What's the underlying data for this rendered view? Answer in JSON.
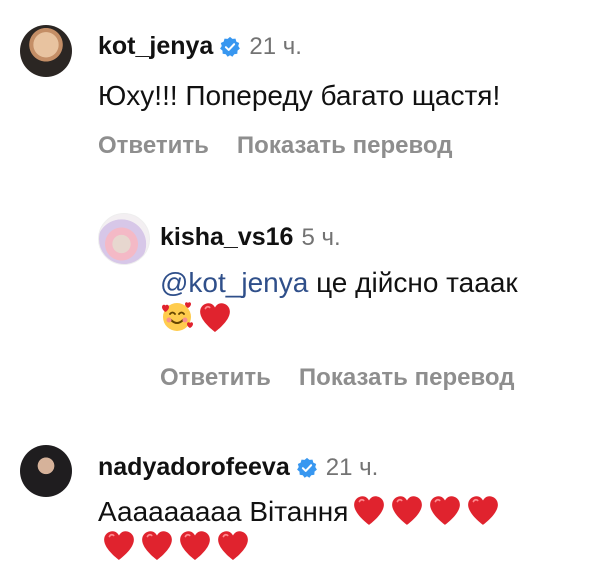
{
  "comments": [
    {
      "username": "kot_jenya",
      "verified": true,
      "time": "21 ч.",
      "text": "Юху!!! Попереду багато щастя!",
      "actions": [
        "Ответить",
        "Показать перевод"
      ]
    },
    {
      "username": "kisha_vs16",
      "verified": false,
      "time": "5 ч.",
      "mention": "@kot_jenya",
      "text": " це дійсно тааак",
      "emojis": [
        "smiling-face-with-hearts",
        "red-heart"
      ],
      "actions": [
        "Ответить",
        "Показать перевод"
      ]
    },
    {
      "username": "nadyadorofeeva",
      "verified": true,
      "time": "21 ч.",
      "text": "Ааааааааа Вітання",
      "hearts_line1": 4,
      "hearts_line2": 4
    }
  ],
  "colors": {
    "verified": "#3897f0",
    "heart": "#e0232e",
    "secondary": "#8e8e8e",
    "mention": "#2f4f8a"
  }
}
